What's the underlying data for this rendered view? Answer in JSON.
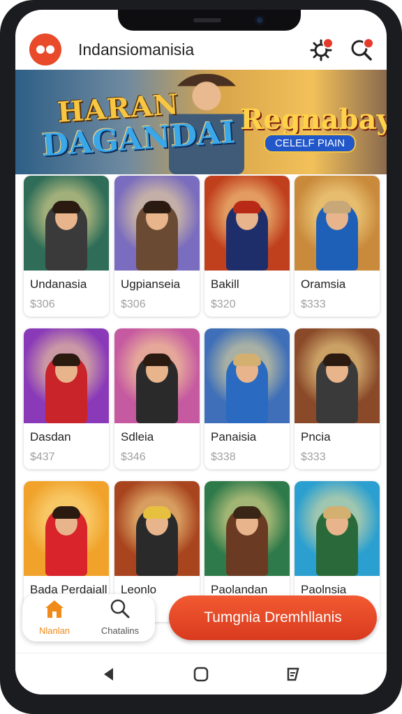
{
  "app": {
    "title": "Indansiomanisia"
  },
  "banner": {
    "line1": "HARAN",
    "line2": "DAGANDAI",
    "logo_text": "Regnabay",
    "pill_text": "CELELF PIAIN"
  },
  "products": [
    {
      "name": "Undanasia",
      "price": "$306",
      "bg": "#2f6d58",
      "hair": "#2a1a10",
      "shirt": "#3a3a3a"
    },
    {
      "name": "Ugpianseia",
      "price": "$306",
      "bg": "#7a6cbe",
      "hair": "#2a1a10",
      "shirt": "#6a4a32"
    },
    {
      "name": "Bakill",
      "price": "$320",
      "bg": "#c0401e",
      "hair": "#b82a16",
      "shirt": "#1e2e6a"
    },
    {
      "name": "Oramsia",
      "price": "$333",
      "bg": "#c98a3c",
      "hair": "#c8a878",
      "shirt": "#1e5fb8"
    },
    {
      "name": "Dasdan",
      "price": "$437",
      "bg": "#8a3ab8",
      "hair": "#2a1a10",
      "shirt": "#c8242a"
    },
    {
      "name": "Sdleia",
      "price": "$346",
      "bg": "#c65aa0",
      "hair": "#2a1a10",
      "shirt": "#2a2a2a"
    },
    {
      "name": "Panaisia",
      "price": "$338",
      "bg": "#3e6fb8",
      "hair": "#d4b070",
      "shirt": "#2a6ac0"
    },
    {
      "name": "Pncia",
      "price": "$333",
      "bg": "#8a4a2a",
      "hair": "#2a1a10",
      "shirt": "#3a3a3a"
    },
    {
      "name": "Bada Perdaiall",
      "price": "",
      "bg": "#f0a22a",
      "hair": "#2a1a10",
      "shirt": "#d8242a"
    },
    {
      "name": "Leonlo",
      "price": "",
      "bg": "#a8441e",
      "hair": "#e8c040",
      "shirt": "#2a2a2a"
    },
    {
      "name": "Paolandan",
      "price": "",
      "bg": "#2f7a4a",
      "hair": "#3a2616",
      "shirt": "#6a3a22"
    },
    {
      "name": "Paolnsia",
      "price": "",
      "bg": "#2a9fd0",
      "hair": "#d4b070",
      "shirt": "#2a6a3a"
    }
  ],
  "bottom_nav": {
    "home_label": "Nlanlan",
    "search_label": "Chatalins",
    "active_color": "#f08a1a"
  },
  "cta": {
    "label": "Tumgnia Dremhllanis"
  },
  "colors": {
    "accent": "#e84a2a",
    "price": "#a0a0a0"
  }
}
